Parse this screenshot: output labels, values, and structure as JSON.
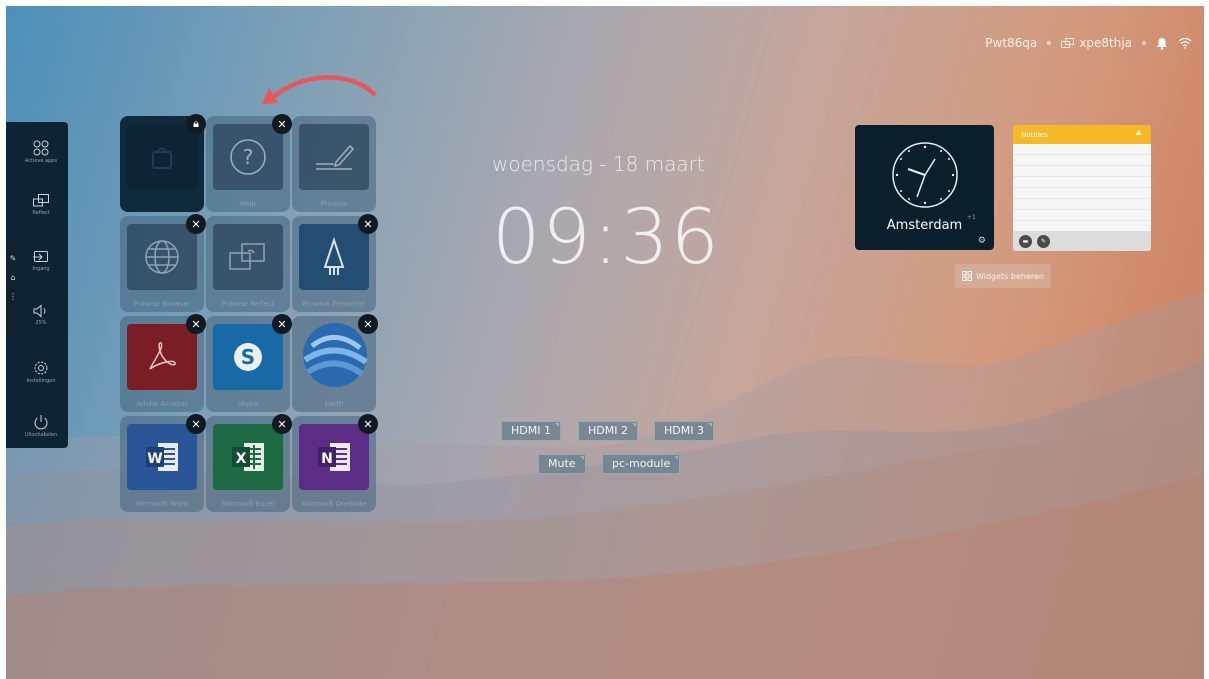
{
  "status_bar": {
    "device_name": "Pwt86qa",
    "cast_name": "xpe8thja"
  },
  "sidebar": {
    "items": [
      {
        "label": "Actieve apps",
        "icon": "apps-icon"
      },
      {
        "label": "Reflect",
        "icon": "reflect-icon"
      },
      {
        "label": "Ingang",
        "icon": "input-icon"
      },
      {
        "label": "25%",
        "icon": "volume-icon"
      },
      {
        "label": "Instellingen",
        "icon": "settings-icon"
      },
      {
        "label": "Uitschakelen",
        "icon": "power-icon"
      }
    ]
  },
  "apps": [
    {
      "label": "",
      "icon": "store-icon",
      "badge": "lock"
    },
    {
      "label": "Help",
      "icon": "help-icon",
      "badge": "close"
    },
    {
      "label": "Prowise",
      "icon": "pen-icon",
      "badge": "none"
    },
    {
      "label": "Prowise Browser",
      "icon": "globe-icon",
      "badge": "close"
    },
    {
      "label": "Prowise Reflect",
      "icon": "reflect-icon",
      "badge": "none"
    },
    {
      "label": "Prowise Presenter",
      "icon": "presenter-icon",
      "badge": "close"
    },
    {
      "label": "Adobe Acrobat",
      "icon": "acrobat-icon",
      "badge": "close"
    },
    {
      "label": "Skype",
      "icon": "skype-icon",
      "badge": "close"
    },
    {
      "label": "Earth",
      "icon": "earth-icon",
      "badge": "close"
    },
    {
      "label": "Microsoft Word",
      "icon": "word-icon",
      "badge": "close"
    },
    {
      "label": "Microsoft Excel",
      "icon": "excel-icon",
      "badge": "close"
    },
    {
      "label": "Microsoft OneNote",
      "icon": "onenote-icon",
      "badge": "close"
    }
  ],
  "clock": {
    "date": "woensdag - 18 maart",
    "time": "09:36"
  },
  "sources": {
    "row1": [
      "HDMI 1",
      "HDMI 2",
      "HDMI 3"
    ],
    "row2": [
      "Mute",
      "pc-module"
    ]
  },
  "widgets": {
    "world_clock": {
      "city": "Amsterdam",
      "offset": "+1"
    },
    "notes": {
      "title": "Notities"
    },
    "manage_label": "Widgets beheren"
  },
  "colors": {
    "notes_accent": "#f5b827",
    "sidebar_bg": "#0d2434",
    "arrow": "#e8585a"
  }
}
